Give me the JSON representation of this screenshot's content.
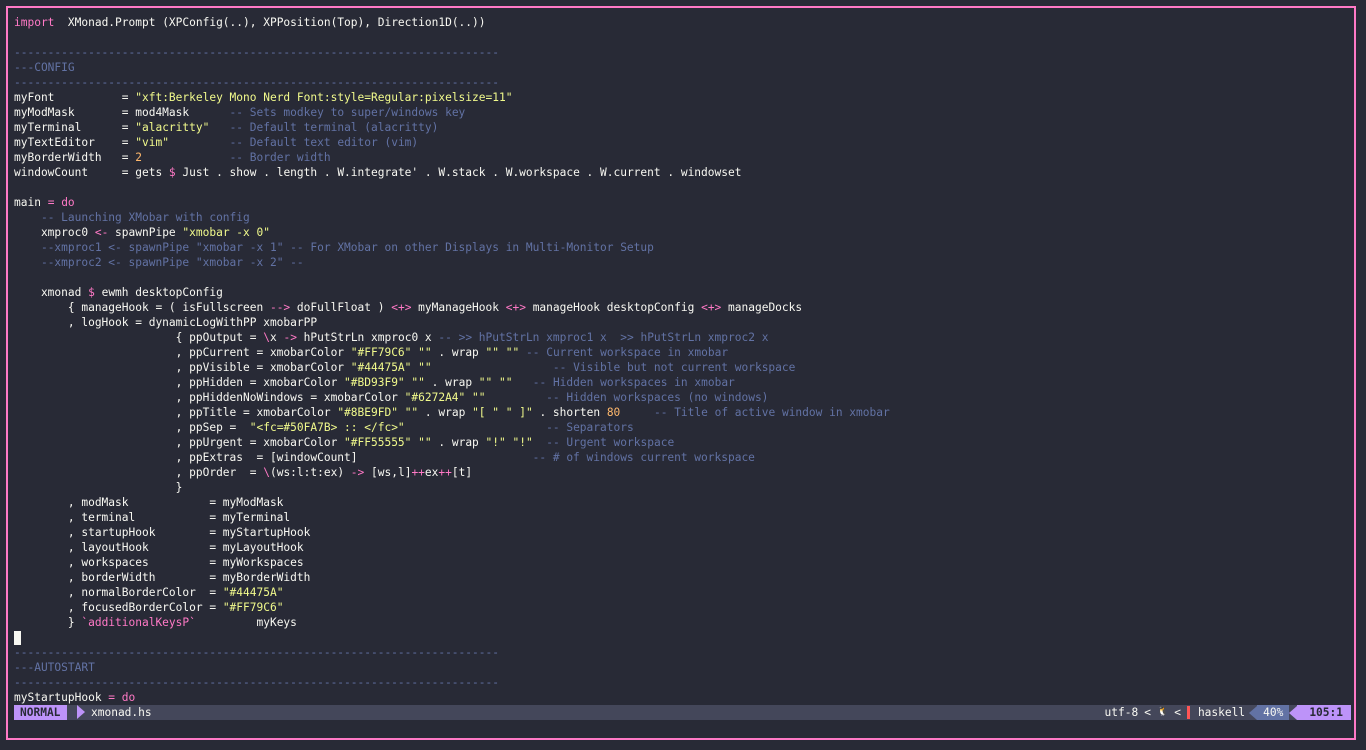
{
  "editor": {
    "lines": [
      [
        [
          "kw",
          "import"
        ],
        [
          "",
          "  XMonad.Prompt (XPConfig(..), XPPosition(Top), Direction1D(..))"
        ]
      ],
      [],
      [
        [
          "cm",
          "------------------------------------------------------------------------"
        ]
      ],
      [
        [
          "cm",
          "---CONFIG"
        ]
      ],
      [
        [
          "cm",
          "------------------------------------------------------------------------"
        ]
      ],
      [
        [
          "",
          "myFont          = "
        ],
        [
          "st",
          "\"xft:Berkeley Mono Nerd Font:style=Regular:pixelsize=11\""
        ]
      ],
      [
        [
          "",
          "myModMask       = mod4Mask      "
        ],
        [
          "cm",
          "-- Sets modkey to super/windows key"
        ]
      ],
      [
        [
          "",
          "myTerminal      = "
        ],
        [
          "st",
          "\"alacritty\""
        ],
        [
          "",
          "   "
        ],
        [
          "cm",
          "-- Default terminal (alacritty)"
        ]
      ],
      [
        [
          "",
          "myTextEditor    = "
        ],
        [
          "st",
          "\"vim\""
        ],
        [
          "",
          "         "
        ],
        [
          "cm",
          "-- Default text editor (vim)"
        ]
      ],
      [
        [
          "",
          "myBorderWidth   = "
        ],
        [
          "nm",
          "2"
        ],
        [
          "",
          "             "
        ],
        [
          "cm",
          "-- Border width"
        ]
      ],
      [
        [
          "",
          "windowCount     = gets "
        ],
        [
          "kw",
          "$"
        ],
        [
          "",
          " Just . show . length . W.integrate' . W.stack . W.workspace . W.current . windowset"
        ]
      ],
      [],
      [
        [
          "",
          "main "
        ],
        [
          "kw",
          "="
        ],
        [
          "",
          " "
        ],
        [
          "kw",
          "do"
        ]
      ],
      [
        [
          "",
          "    "
        ],
        [
          "cm",
          "-- Launching XMobar with config"
        ]
      ],
      [
        [
          "",
          "    xmproc0 "
        ],
        [
          "kw",
          "<-"
        ],
        [
          "",
          " spawnPipe "
        ],
        [
          "st",
          "\"xmobar -x 0\""
        ]
      ],
      [
        [
          "",
          "    "
        ],
        [
          "cm",
          "--xmproc1 <- spawnPipe \"xmobar -x 1\" -- For XMobar on other Displays in Multi-Monitor Setup"
        ]
      ],
      [
        [
          "",
          "    "
        ],
        [
          "cm",
          "--xmproc2 <- spawnPipe \"xmobar -x 2\" --"
        ]
      ],
      [],
      [
        [
          "",
          "    xmonad "
        ],
        [
          "kw",
          "$"
        ],
        [
          "",
          " ewmh desktopConfig"
        ]
      ],
      [
        [
          "",
          "        { manageHook = ( isFullscreen "
        ],
        [
          "kw",
          "-->"
        ],
        [
          "",
          " doFullFloat ) "
        ],
        [
          "kw",
          "<+>"
        ],
        [
          "",
          " myManageHook "
        ],
        [
          "kw",
          "<+>"
        ],
        [
          "",
          " manageHook desktopConfig "
        ],
        [
          "kw",
          "<+>"
        ],
        [
          "",
          " manageDocks"
        ]
      ],
      [
        [
          "",
          "        , logHook = dynamicLogWithPP xmobarPP"
        ]
      ],
      [
        [
          "",
          "                        { ppOutput = "
        ],
        [
          "kw",
          "\\"
        ],
        [
          "",
          "x "
        ],
        [
          "kw",
          "->"
        ],
        [
          "",
          " hPutStrLn xmproc0 x "
        ],
        [
          "cm",
          "-- >> hPutStrLn xmproc1 x  >> hPutStrLn xmproc2 x"
        ]
      ],
      [
        [
          "",
          "                        , ppCurrent = xmobarColor "
        ],
        [
          "st",
          "\"#FF79C6\""
        ],
        [
          "",
          " "
        ],
        [
          "st",
          "\"\""
        ],
        [
          "",
          " . wrap "
        ],
        [
          "st",
          "\"\""
        ],
        [
          "",
          " "
        ],
        [
          "st",
          "\"\""
        ],
        [
          "",
          " "
        ],
        [
          "cm",
          "-- Current workspace in xmobar"
        ]
      ],
      [
        [
          "",
          "                        , ppVisible = xmobarColor "
        ],
        [
          "st",
          "\"#44475A\""
        ],
        [
          "",
          " "
        ],
        [
          "st",
          "\"\""
        ],
        [
          "",
          "                  "
        ],
        [
          "cm",
          "-- Visible but not current workspace"
        ]
      ],
      [
        [
          "",
          "                        , ppHidden = xmobarColor "
        ],
        [
          "st",
          "\"#BD93F9\""
        ],
        [
          "",
          " "
        ],
        [
          "st",
          "\"\""
        ],
        [
          "",
          " . wrap "
        ],
        [
          "st",
          "\"\""
        ],
        [
          "",
          " "
        ],
        [
          "st",
          "\"\""
        ],
        [
          "",
          "   "
        ],
        [
          "cm",
          "-- Hidden workspaces in xmobar"
        ]
      ],
      [
        [
          "",
          "                        , ppHiddenNoWindows = xmobarColor "
        ],
        [
          "st",
          "\"#6272A4\""
        ],
        [
          "",
          " "
        ],
        [
          "st",
          "\"\""
        ],
        [
          "",
          "         "
        ],
        [
          "cm",
          "-- Hidden workspaces (no windows)"
        ]
      ],
      [
        [
          "",
          "                        , ppTitle = xmobarColor "
        ],
        [
          "st",
          "\"#8BE9FD\""
        ],
        [
          "",
          " "
        ],
        [
          "st",
          "\"\""
        ],
        [
          "",
          " . wrap "
        ],
        [
          "st",
          "\"[ \""
        ],
        [
          "",
          " "
        ],
        [
          "st",
          "\" ]\""
        ],
        [
          "",
          " . shorten "
        ],
        [
          "nm",
          "80"
        ],
        [
          "",
          "     "
        ],
        [
          "cm",
          "-- Title of active window in xmobar"
        ]
      ],
      [
        [
          "",
          "                        , ppSep =  "
        ],
        [
          "st",
          "\"<fc=#50FA7B> :: </fc>\""
        ],
        [
          "",
          "                     "
        ],
        [
          "cm",
          "-- Separators"
        ]
      ],
      [
        [
          "",
          "                        , ppUrgent = xmobarColor "
        ],
        [
          "st",
          "\"#FF55555\""
        ],
        [
          "",
          " "
        ],
        [
          "st",
          "\"\""
        ],
        [
          "",
          " . wrap "
        ],
        [
          "st",
          "\"!\""
        ],
        [
          "",
          " "
        ],
        [
          "st",
          "\"!\""
        ],
        [
          "",
          "  "
        ],
        [
          "cm",
          "-- Urgent workspace"
        ]
      ],
      [
        [
          "",
          "                        , ppExtras  = [windowCount]                          "
        ],
        [
          "cm",
          "-- # of windows current workspace"
        ]
      ],
      [
        [
          "",
          "                        , ppOrder  = "
        ],
        [
          "kw",
          "\\"
        ],
        [
          "",
          "(ws:l:t:ex) "
        ],
        [
          "kw",
          "->"
        ],
        [
          "",
          " [ws,l]"
        ],
        [
          "kw",
          "++"
        ],
        [
          "",
          "ex"
        ],
        [
          "kw",
          "++"
        ],
        [
          "",
          "[t]"
        ]
      ],
      [
        [
          "",
          "                        }"
        ]
      ],
      [
        [
          "",
          "        , modMask            = myModMask"
        ]
      ],
      [
        [
          "",
          "        , terminal           = myTerminal"
        ]
      ],
      [
        [
          "",
          "        , startupHook        = myStartupHook"
        ]
      ],
      [
        [
          "",
          "        , layoutHook         = myLayoutHook"
        ]
      ],
      [
        [
          "",
          "        , workspaces         = myWorkspaces"
        ]
      ],
      [
        [
          "",
          "        , borderWidth        = myBorderWidth"
        ]
      ],
      [
        [
          "",
          "        , normalBorderColor  = "
        ],
        [
          "st",
          "\"#44475A\""
        ]
      ],
      [
        [
          "",
          "        , focusedBorderColor = "
        ],
        [
          "st",
          "\"#FF79C6\""
        ]
      ],
      [
        [
          "",
          "        } "
        ],
        [
          "kw",
          "`additionalKeysP`"
        ],
        [
          "",
          "         myKeys"
        ]
      ],
      [
        [
          "cursor",
          ""
        ]
      ],
      [
        [
          "cm",
          "------------------------------------------------------------------------"
        ]
      ],
      [
        [
          "cm",
          "---AUTOSTART"
        ]
      ],
      [
        [
          "cm",
          "------------------------------------------------------------------------"
        ]
      ],
      [
        [
          "",
          "myStartupHook "
        ],
        [
          "kw",
          "="
        ],
        [
          "",
          " "
        ],
        [
          "kw",
          "do"
        ]
      ]
    ]
  },
  "statusbar": {
    "mode": "NORMAL",
    "filename": "xmonad.hs",
    "encoding": "utf-8",
    "chev1": "<",
    "os_icon": "🐧",
    "chev2": "<",
    "filetype": "haskell",
    "percent": "40%",
    "position": "105:1"
  },
  "colors": {
    "background": "#282a36",
    "border": "#ff79c6",
    "mode_bg": "#bd93f9",
    "statusbar_bg": "#44475a",
    "keyword": "#ff79c6",
    "string": "#f1fa8c",
    "comment": "#6272a4",
    "number": "#ffb86c"
  }
}
